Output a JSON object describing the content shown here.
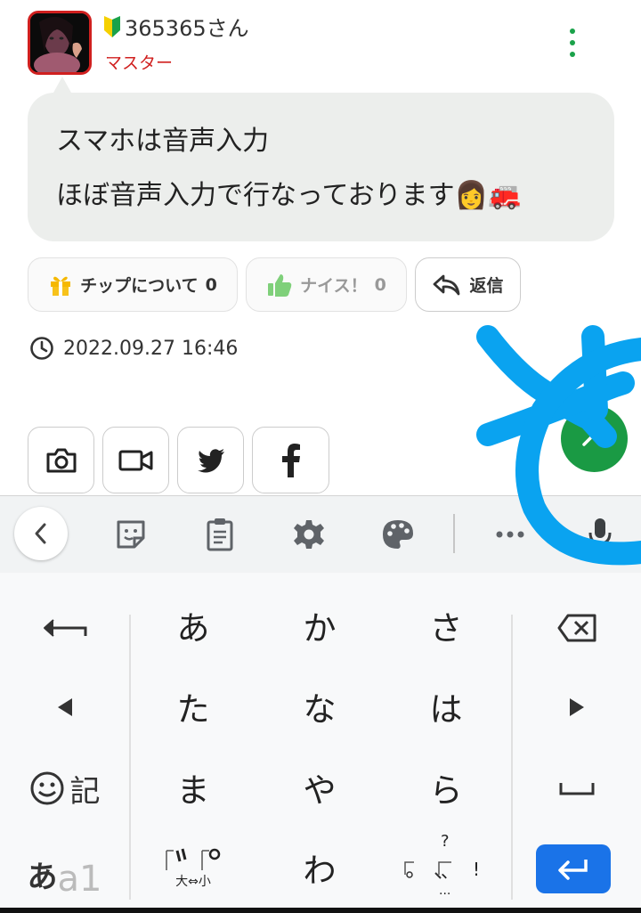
{
  "post": {
    "username": "365365さん",
    "rank": "マスター",
    "message_lines": [
      "スマホは音声入力",
      "ほぼ音声入力で行なっております👩🚒"
    ],
    "tip_label": "チップについて",
    "tip_count": "0",
    "nice_label": "ナイス！",
    "nice_count": "0",
    "reply_label": "返信",
    "timestamp": "2022.09.27 16:46"
  },
  "share": {
    "icons": [
      "camera-icon",
      "video-icon",
      "twitter-icon",
      "facebook-icon"
    ]
  },
  "keyboard": {
    "toolbar_icons": [
      "back-chevron-icon",
      "sticker-icon",
      "clipboard-icon",
      "settings-icon",
      "palette-icon",
      "more-icon",
      "microphone-icon"
    ],
    "rows": [
      [
        "あ",
        "か",
        "さ"
      ],
      [
        "た",
        "な",
        "は"
      ],
      [
        "ま",
        "や",
        "ら"
      ],
      [
        "゛゜大⇔小",
        "わ",
        "、。?!"
      ]
    ],
    "left_keys": {
      "emoji_label": "記",
      "mode_label_a": "あ",
      "mode_label_b": "a1"
    },
    "dakuten_label": "大⇔小",
    "punct_q": "?",
    "punct_comma": "、",
    "punct_excl": "!",
    "punct_dots": "..."
  },
  "colors": {
    "accent_green": "#1a9a44",
    "rank_red": "#d0201f",
    "enter_blue": "#1a73e8",
    "scribble_blue": "#0aa3f0"
  }
}
